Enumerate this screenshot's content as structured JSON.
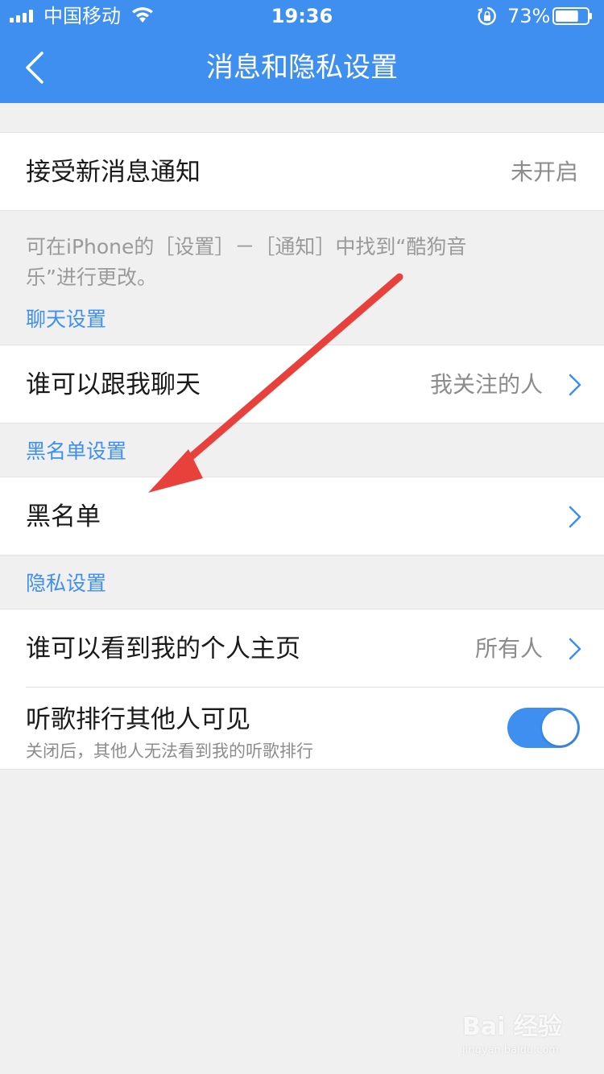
{
  "status_bar": {
    "carrier": "中国移动",
    "time": "19:36",
    "battery_percent": "73%",
    "battery_level": 0.73,
    "icons": [
      "signal-icon",
      "wifi-icon",
      "orientation-lock-icon",
      "battery-icon"
    ]
  },
  "nav": {
    "title": "消息和隐私设置",
    "back_icon": "chevron-left-icon"
  },
  "notifications": {
    "label": "接受新消息通知",
    "value": "未开启",
    "hint_line1": "可在iPhone的［设置］－［通知］中找到“酷狗音",
    "hint_line2": "乐”进行更改。"
  },
  "chat_section": {
    "title": "聊天设置",
    "row_label": "谁可以跟我聊天",
    "row_value": "我关注的人"
  },
  "blacklist_section": {
    "title": "黑名单设置",
    "row_label": "黑名单"
  },
  "privacy_section": {
    "title": "隐私设置",
    "homepage_label": "谁可以看到我的个人主页",
    "homepage_value": "所有人",
    "ranking_label": "听歌排行其他人可见",
    "ranking_sub": "关闭后，其他人无法看到我的听歌排行",
    "ranking_enabled": true
  },
  "annotation": {
    "arrow_color": "#e8413c"
  },
  "watermark": {
    "logo": "Bai 经验",
    "url": "jingyan.baidu.com"
  },
  "colors": {
    "header_bg": "#3e8ff0",
    "accent": "#3e8ff0",
    "page_bg": "#f0f0f0"
  }
}
